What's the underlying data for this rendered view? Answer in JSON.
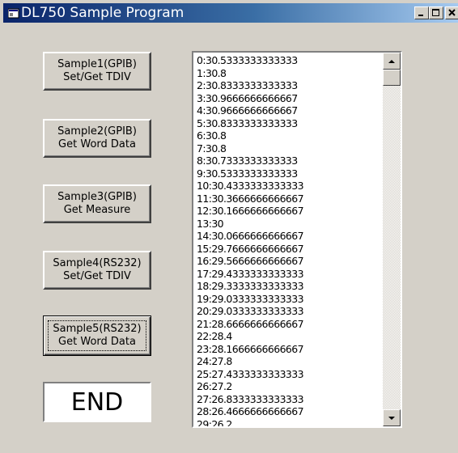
{
  "window": {
    "title": "DL750 Sample Program",
    "icon": "app-window-icon",
    "caption_buttons": [
      "minimize-icon",
      "maximize-icon",
      "close-icon"
    ]
  },
  "buttons": [
    {
      "label": "Sample1(GPIB)\nSet/Get TDIV"
    },
    {
      "label": "Sample2(GPIB)\nGet Word Data"
    },
    {
      "label": "Sample3(GPIB)\nGet Measure"
    },
    {
      "label": "Sample4(RS232)\nSet/Get TDIV"
    },
    {
      "label": "Sample5(RS232)\nGet Word Data",
      "focused": true
    }
  ],
  "end_label": "END",
  "list": {
    "items": [
      "0:30.5333333333333",
      "1:30.8",
      "2:30.8333333333333",
      "3:30.9666666666667",
      "4:30.9666666666667",
      "5:30.8333333333333",
      "6:30.8",
      "7:30.8",
      "8:30.7333333333333",
      "9:30.5333333333333",
      "10:30.4333333333333",
      "11:30.3666666666667",
      "12:30.1666666666667",
      "13:30",
      "14:30.0666666666667",
      "15:29.7666666666667",
      "16:29.5666666666667",
      "17:29.4333333333333",
      "18:29.3333333333333",
      "19:29.0333333333333",
      "20:29.0333333333333",
      "21:28.6666666666667",
      "22:28.4",
      "23:28.1666666666667",
      "24:27.8",
      "25:27.4333333333333",
      "26:27.2",
      "27:26.8333333333333",
      "28:26.4666666666667",
      "29:26.2"
    ],
    "scroll_position": 0
  }
}
